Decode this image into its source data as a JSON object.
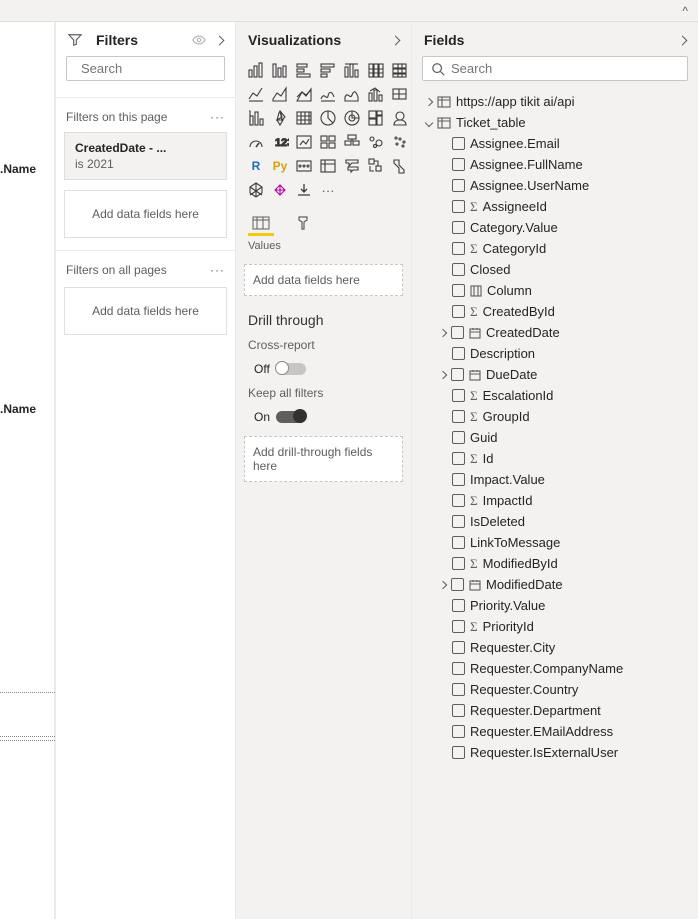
{
  "filters": {
    "title": "Filters",
    "search_placeholder": "Search",
    "section_page": "Filters on this page",
    "section_all": "Filters on all pages",
    "card_title": "CreatedDate - ...",
    "card_sub": "is 2021",
    "drop_text": "Add data fields here"
  },
  "viz": {
    "title": "Visualizations",
    "values_label": "Values",
    "add_fields": "Add data fields here",
    "drill_title": "Drill through",
    "cross_report": "Cross-report",
    "off": "Off",
    "keep_all": "Keep all filters",
    "on": "On",
    "add_drill": "Add drill-through fields here"
  },
  "fields": {
    "title": "Fields",
    "search_placeholder": "Search",
    "source": "https://app tikit ai/api",
    "table": "Ticket_table",
    "rows": [
      {
        "label": "Assignee.Email",
        "sigma": false,
        "date": false
      },
      {
        "label": "Assignee.FullName",
        "sigma": false,
        "date": false
      },
      {
        "label": "Assignee.UserName",
        "sigma": false,
        "date": false
      },
      {
        "label": "AssigneeId",
        "sigma": true,
        "date": false
      },
      {
        "label": "Category.Value",
        "sigma": false,
        "date": false
      },
      {
        "label": "CategoryId",
        "sigma": true,
        "date": false
      },
      {
        "label": "Closed",
        "sigma": false,
        "date": false
      },
      {
        "label": "Column",
        "sigma": false,
        "date": false,
        "col": true
      },
      {
        "label": "CreatedById",
        "sigma": true,
        "date": false
      },
      {
        "label": "CreatedDate",
        "sigma": false,
        "date": true,
        "expand": true
      },
      {
        "label": "Description",
        "sigma": false,
        "date": false
      },
      {
        "label": "DueDate",
        "sigma": false,
        "date": true,
        "expand": true
      },
      {
        "label": "EscalationId",
        "sigma": true,
        "date": false
      },
      {
        "label": "GroupId",
        "sigma": true,
        "date": false
      },
      {
        "label": "Guid",
        "sigma": false,
        "date": false
      },
      {
        "label": "Id",
        "sigma": true,
        "date": false
      },
      {
        "label": "Impact.Value",
        "sigma": false,
        "date": false
      },
      {
        "label": "ImpactId",
        "sigma": true,
        "date": false
      },
      {
        "label": "IsDeleted",
        "sigma": false,
        "date": false
      },
      {
        "label": "LinkToMessage",
        "sigma": false,
        "date": false
      },
      {
        "label": "ModifiedById",
        "sigma": true,
        "date": false
      },
      {
        "label": "ModifiedDate",
        "sigma": false,
        "date": true,
        "expand": true
      },
      {
        "label": "Priority.Value",
        "sigma": false,
        "date": false
      },
      {
        "label": "PriorityId",
        "sigma": true,
        "date": false
      },
      {
        "label": "Requester.City",
        "sigma": false,
        "date": false
      },
      {
        "label": "Requester.CompanyName",
        "sigma": false,
        "date": false
      },
      {
        "label": "Requester.Country",
        "sigma": false,
        "date": false
      },
      {
        "label": "Requester.Department",
        "sigma": false,
        "date": false
      },
      {
        "label": "Requester.EMailAddress",
        "sigma": false,
        "date": false
      },
      {
        "label": "Requester.IsExternalUser",
        "sigma": false,
        "date": false
      }
    ]
  },
  "canvas": {
    "stub1": ".Name",
    "stub2": ".Name"
  }
}
